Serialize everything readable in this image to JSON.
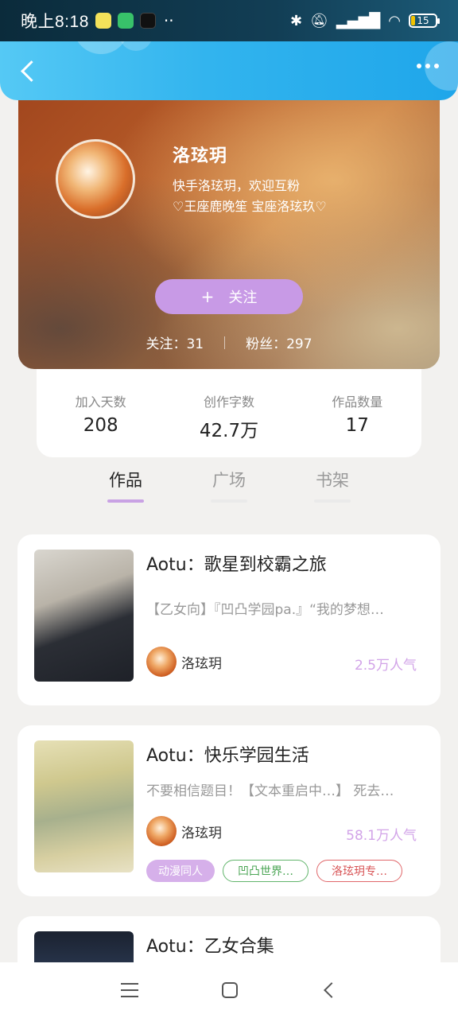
{
  "status_bar": {
    "time": "晚上8:18",
    "more": "··",
    "battery": "15"
  },
  "profile": {
    "name": "洛玹玥",
    "bio_line1": "快手洛玹玥，欢迎互粉",
    "bio_line2": "♡王座鹿晚笙 宝座洛玹玖♡",
    "follow_plus": "+",
    "follow_label": "关注",
    "following": "关注：31",
    "fans": "粉丝：297"
  },
  "stats": [
    {
      "label": "加入天数",
      "value": "208"
    },
    {
      "label": "创作字数",
      "value": "42.7万"
    },
    {
      "label": "作品数量",
      "value": "17"
    }
  ],
  "tabs": [
    "作品",
    "广场",
    "书架"
  ],
  "works": [
    {
      "title": "Aotu：歌星到校霸之旅",
      "desc": "【乙女向】『凹凸学园pa.』“我的梦想…",
      "author": "洛玹玥",
      "popularity": "2.5万人气"
    },
    {
      "title": "Aotu：快乐学园生活",
      "desc": "不要相信题目！【文本重启中…】 死去…",
      "author": "洛玹玥",
      "popularity": "58.1万人气",
      "tags": [
        "动漫同人",
        "凹凸世界…",
        "洛玹玥专…"
      ]
    },
    {
      "title": "Aotu：乙女合集"
    }
  ],
  "colors": {
    "accent": "#c89ae6",
    "popularity": "#d2a4e8",
    "navbar": "#32b4ee"
  }
}
